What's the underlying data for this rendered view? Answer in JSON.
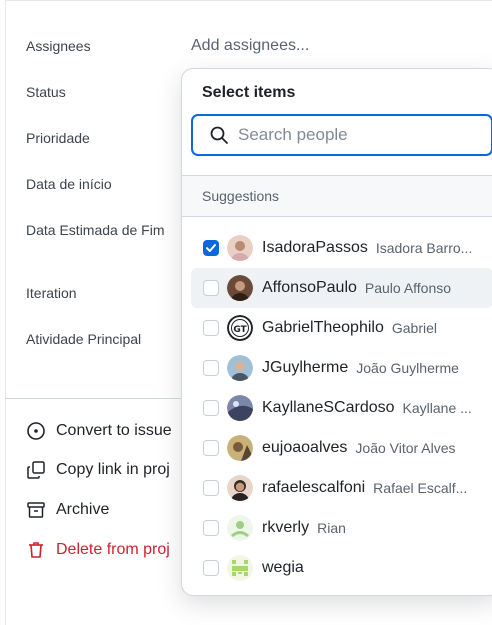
{
  "fields": [
    {
      "key": "assignees",
      "label": "Assignees"
    },
    {
      "key": "status",
      "label": "Status"
    },
    {
      "key": "priority",
      "label": "Prioridade"
    },
    {
      "key": "start",
      "label": "Data de início"
    },
    {
      "key": "end",
      "label": "Data Estimada de Fim"
    },
    {
      "key": "iteration",
      "label": "Iteration"
    },
    {
      "key": "activity",
      "label": "Atividade Principal"
    }
  ],
  "assignees_placeholder": "Add assignees...",
  "actions": {
    "convert": "Convert to issue",
    "copy": "Copy link in proj",
    "archive": "Archive",
    "delete": "Delete from proj"
  },
  "dropdown": {
    "title": "Select items",
    "search_placeholder": "Search people",
    "section_label": "Suggestions",
    "items": [
      {
        "login": "IsadoraPassos",
        "name": "Isadora Barro...",
        "checked": true,
        "avatar_color": "#e8c7b8"
      },
      {
        "login": "AffonsoPaulo",
        "name": "Paulo Affonso",
        "checked": false,
        "avatar_color": "#5a3a2e"
      },
      {
        "login": "GabrielTheophilo",
        "name": "Gabriel",
        "checked": false,
        "avatar_color": "#ffffff"
      },
      {
        "login": "JGuylherme",
        "name": "João Guylherme",
        "checked": false,
        "avatar_color": "#8fb2c9"
      },
      {
        "login": "KayllaneSCardoso",
        "name": "Kayllane ...",
        "checked": false,
        "avatar_color": "#6d7a9e"
      },
      {
        "login": "eujoaoalves",
        "name": "João Vitor Alves",
        "checked": false,
        "avatar_color": "#a89060"
      },
      {
        "login": "rafaelescalfoni",
        "name": "Rafael Escalf...",
        "checked": false,
        "avatar_color": "#3b2c26"
      },
      {
        "login": "rkverly",
        "name": "Rian",
        "checked": false,
        "avatar_color": "#cfe8c3"
      },
      {
        "login": "wegia",
        "name": "",
        "checked": false,
        "avatar_color": "#c8e59c"
      }
    ]
  },
  "colors": {
    "accent": "#0969da",
    "danger": "#cf222e"
  }
}
